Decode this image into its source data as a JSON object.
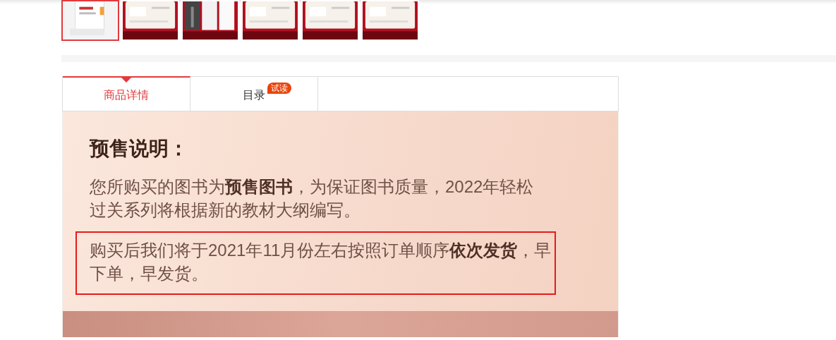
{
  "thumbnails": [
    {
      "kind": "picture",
      "selected": true
    },
    {
      "kind": "picture",
      "selected": false
    },
    {
      "kind": "picture",
      "selected": false
    },
    {
      "kind": "picture",
      "selected": false
    },
    {
      "kind": "picture",
      "selected": false
    },
    {
      "kind": "picture",
      "selected": false
    }
  ],
  "tabs": [
    {
      "label": "商品详情",
      "selected": true
    },
    {
      "label": "目录",
      "selected": false,
      "badge": "试读"
    }
  ],
  "notice": {
    "title": "预售说明：",
    "paragraphs": [
      {
        "text": "您所购买的图书为**预售图书**，为保证图书质量，2022年轻松过关系列将根据新的教材大纲编写。",
        "highlighted": false
      },
      {
        "text": "购买后我们将于2021年11月份左右按照订单顺序**依次发货**，早下单，早发货。",
        "highlighted": true
      }
    ]
  }
}
